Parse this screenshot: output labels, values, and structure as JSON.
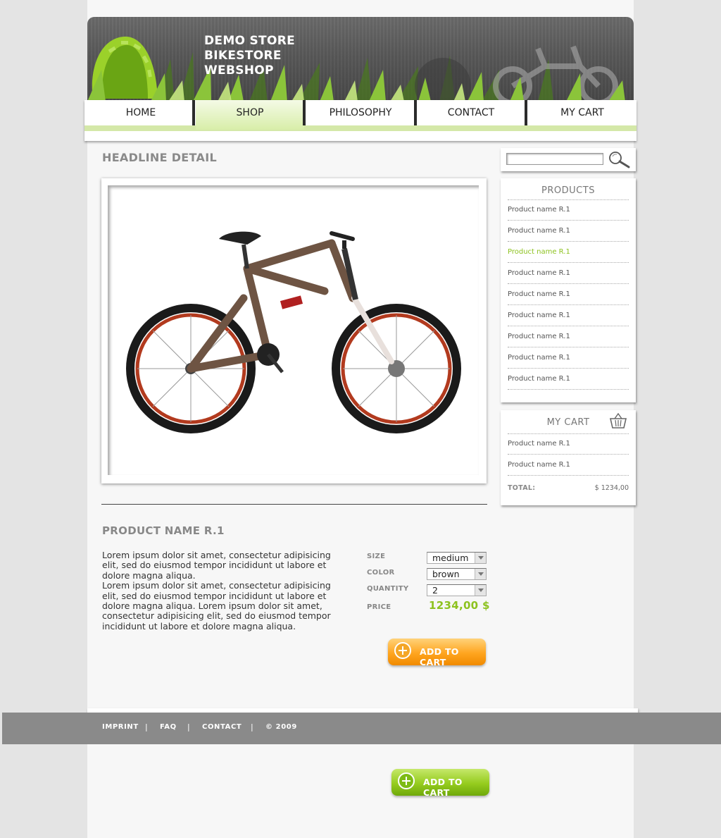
{
  "header": {
    "title_lines": [
      "DEMO STORE",
      "BIKESTORE",
      "WEBSHOP"
    ]
  },
  "nav": {
    "items": [
      {
        "label": "HOME"
      },
      {
        "label": "SHOP"
      },
      {
        "label": "PHILOSOPHY"
      },
      {
        "label": "CONTACT"
      },
      {
        "label": "MY CART"
      }
    ],
    "active": "SHOP"
  },
  "main": {
    "headline": "HEADLINE DETAIL",
    "product_name": "PRODUCT NAME R.1",
    "description": [
      "Lorem ipsum dolor sit amet, consectetur adipisicing elit, sed do eiusmod tempor incididunt ut labore et dolore magna aliqua.",
      "Lorem ipsum dolor sit amet, consectetur adipisicing elit, sed do eiusmod tempor incididunt ut labore et dolore magna aliqua. Lorem ipsum dolor sit amet, consectetur adipisicing elit, sed do eiusmod tempor incididunt ut labore et dolore magna aliqua."
    ],
    "options": {
      "size": {
        "label": "SIZE",
        "value": "medium"
      },
      "color": {
        "label": "COLOR",
        "value": "brown"
      },
      "quantity": {
        "label": "QUANTITY",
        "value": "2"
      },
      "price": {
        "label": "PRICE",
        "value": "1234,00 $"
      }
    },
    "add_to_cart_label": "ADD TO CART"
  },
  "sidebar": {
    "products": {
      "title": "PRODUCTS",
      "items": [
        {
          "label": "Product name R.1"
        },
        {
          "label": "Product name R.1"
        },
        {
          "label": "Product name R.1",
          "active": true
        },
        {
          "label": "Product name R.1"
        },
        {
          "label": "Product name R.1"
        },
        {
          "label": "Product name R.1"
        },
        {
          "label": "Product name R.1"
        },
        {
          "label": "Product name R.1"
        },
        {
          "label": "Product name R.1"
        }
      ]
    },
    "cart": {
      "title": "MY CART",
      "items": [
        {
          "label": "Product name R.1"
        },
        {
          "label": "Product name R.1"
        }
      ],
      "total_label": "TOTAL:",
      "total_value": "$ 1234,00"
    }
  },
  "footer": {
    "links": [
      "IMPRINT",
      "FAQ",
      "CONTACT",
      "© 2009"
    ],
    "separator": "|"
  },
  "extra_button": {
    "label": "ADD TO CART"
  },
  "colors": {
    "accent_green": "#8dc21f",
    "nav_active": "#d8eea9",
    "footer_bg": "#8a8a8a",
    "button_orange": "#ffa51f",
    "button_green": "#95cc1e"
  },
  "icons": [
    "search-icon",
    "basket-icon",
    "plus-circle-icon",
    "dropdown-arrow-icon"
  ]
}
